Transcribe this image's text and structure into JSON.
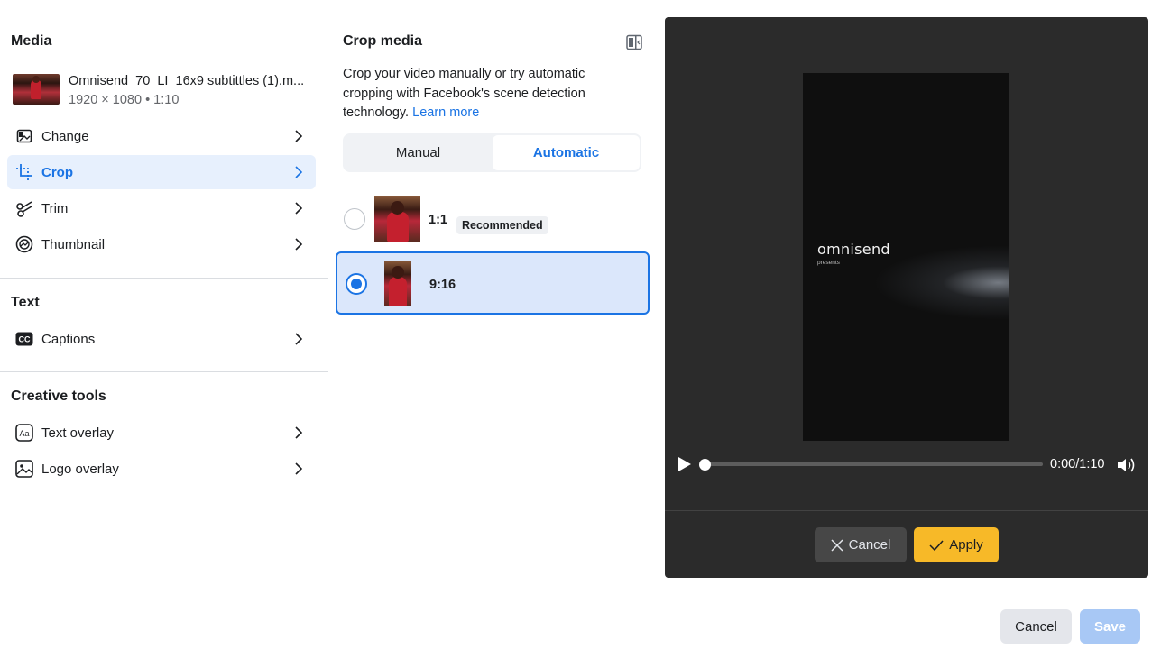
{
  "media": {
    "heading": "Media",
    "file_name": "Omnisend_70_LI_16x9 subtittles (1).m...",
    "file_meta": "1920 × 1080 • 1:10"
  },
  "edit_menu": [
    {
      "label": "Change",
      "icon": "image-icon"
    },
    {
      "label": "Crop",
      "icon": "crop-icon",
      "active": true
    },
    {
      "label": "Trim",
      "icon": "scissors-icon"
    },
    {
      "label": "Thumbnail",
      "icon": "thumbnail-icon"
    }
  ],
  "text_section": {
    "heading": "Text",
    "items": [
      {
        "label": "Captions",
        "icon": "cc-icon"
      }
    ]
  },
  "creative_tools": {
    "heading": "Creative tools",
    "items": [
      {
        "label": "Text overlay",
        "icon": "text-aa-icon"
      },
      {
        "label": "Logo overlay",
        "icon": "logo-image-icon"
      }
    ]
  },
  "crop_panel": {
    "title": "Crop media",
    "description": "Crop your video manually or try automatic cropping with Facebook's scene detection technology.",
    "learn_more": "Learn more",
    "modes": [
      "Manual",
      "Automatic"
    ],
    "selected_mode": "Automatic",
    "options": [
      {
        "ratio": "1:1",
        "badge": "Recommended",
        "selected": false
      },
      {
        "ratio": "9:16",
        "selected": true
      }
    ]
  },
  "preview": {
    "brand_text": "omnisend",
    "brand_subtext": "presents",
    "time": "0:00/1:10",
    "progress": 0,
    "cancel_label": "Cancel",
    "apply_label": "Apply"
  },
  "footer": {
    "cancel_label": "Cancel",
    "save_label": "Save"
  },
  "colors": {
    "accent": "#1b74e4",
    "apply_yellow": "#f7b928",
    "preview_bg": "#2b2b2b",
    "save_disabled": "#a8c8f5"
  }
}
